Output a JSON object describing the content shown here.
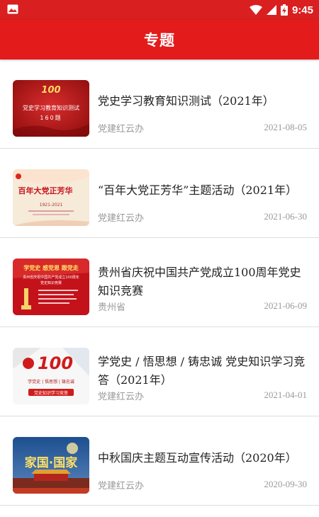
{
  "status_bar": {
    "time": "9:45",
    "icons": [
      "image-icon",
      "wifi-icon",
      "signal-icon",
      "battery-charging-icon"
    ]
  },
  "app_bar": {
    "title": "专题"
  },
  "colors": {
    "primary_red": "#e31b1b",
    "status_red": "#d91f1f",
    "meta_gray": "#9a9a9a"
  },
  "items": [
    {
      "title": "党史学习教育知识测试（2021年）",
      "source": "党建红云办",
      "date": "2021-08-05",
      "thumb": {
        "big": "100",
        "line1": "党史学习教育知识测试",
        "line2": "160题"
      }
    },
    {
      "title": "“百年大党正芳华”主题活动（2021年）",
      "source": "党建红云办",
      "date": "2021-06-30",
      "thumb": {
        "big": "百年大党正芳华",
        "line1": "1921-2021"
      }
    },
    {
      "title": "贵州省庆祝中国共产党成立100周年党史知识竞赛",
      "source": "贵州省",
      "date": "2021-06-09",
      "thumb": {
        "big": "学党史 感党恩 跟党走",
        "line1": "贵州省庆祝中国共产党成立100周年",
        "line2": "党史知识竞赛"
      }
    },
    {
      "title": "学党史 / 悟思想 / 铸忠诚 党史知识学习竞答（2021年）",
      "source": "党建红云办",
      "date": "2021-04-01",
      "thumb": {
        "big": "100",
        "line1": "学党史 | 悟思想 | 铸忠诚",
        "line2": "党史知识学习竞答"
      }
    },
    {
      "title": "中秋国庆主题互动宣传活动（2020年）",
      "source": "党建红云办",
      "date": "2020-09-30",
      "thumb": {
        "big": "家国·国家"
      }
    }
  ]
}
